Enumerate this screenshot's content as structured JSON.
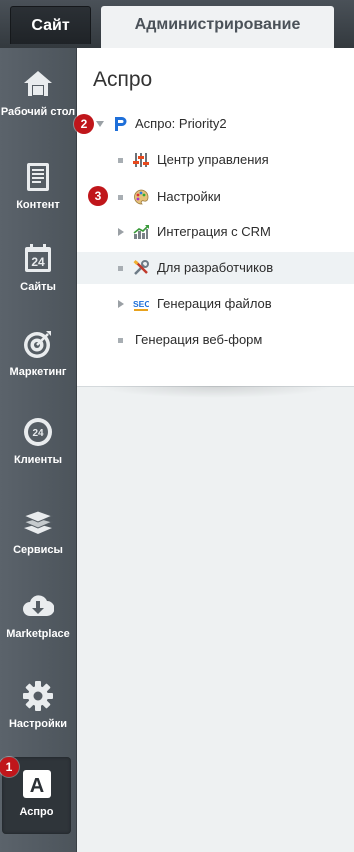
{
  "topbar": {
    "tab_site": "Сайт",
    "tab_admin": "Администрирование"
  },
  "sidebar": {
    "items": [
      {
        "label": "Рабочий стол",
        "icon": "home-icon"
      },
      {
        "label": "Контент",
        "icon": "document-icon"
      },
      {
        "label": "Сайты",
        "icon": "calendar-24-icon"
      },
      {
        "label": "Маркетинг",
        "icon": "target-icon"
      },
      {
        "label": "Клиенты",
        "icon": "cloud-24-icon"
      },
      {
        "label": "Сервисы",
        "icon": "layers-icon"
      },
      {
        "label": "Marketplace",
        "icon": "cloud-download-icon"
      },
      {
        "label": "Настройки",
        "icon": "gear-icon"
      },
      {
        "label": "Аспро",
        "icon": "letter-a-icon",
        "active": true
      }
    ]
  },
  "main": {
    "title": "Аспро",
    "root": {
      "label": "Аспро: Priority2",
      "icon": "priority-logo-icon"
    },
    "items": [
      {
        "label": "Центр управления",
        "icon": "sliders-icon"
      },
      {
        "label": "Настройки",
        "icon": "palette-icon"
      },
      {
        "label": "Интеграция с CRM",
        "icon": "chart-icon"
      },
      {
        "label": "Для разработчиков",
        "icon": "tools-icon"
      },
      {
        "label": "Генерация файлов",
        "icon": "seo-icon"
      },
      {
        "label": "Генерация веб-форм",
        "icon": ""
      }
    ]
  },
  "badges": [
    "1",
    "2",
    "3"
  ],
  "colors": {
    "badge": "#c0161b",
    "sidebar": "#555d64",
    "accent_blue": "#1e6fd9"
  }
}
